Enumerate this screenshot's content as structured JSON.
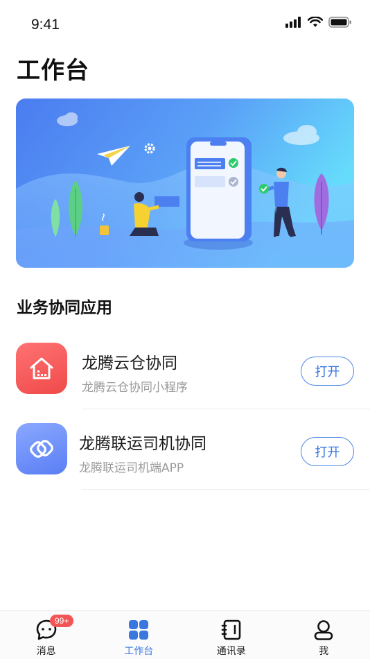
{
  "status_bar": {
    "time": "9:41"
  },
  "page": {
    "title": "工作台"
  },
  "section": {
    "title": "业务协同应用"
  },
  "apps": [
    {
      "name": "龙腾云仓协同",
      "desc": "龙腾云仓协同小程序",
      "button": "打开",
      "icon": "warehouse-house-icon"
    },
    {
      "name": "龙腾联运司机协同",
      "desc": "龙腾联运司机端APP",
      "button": "打开",
      "icon": "link-icon"
    }
  ],
  "tabs": [
    {
      "label": "消息",
      "icon": "chat-bubble-icon",
      "badge": "99+"
    },
    {
      "label": "工作台",
      "icon": "grid-apps-icon",
      "active": true
    },
    {
      "label": "通讯录",
      "icon": "contacts-book-icon"
    },
    {
      "label": "我",
      "icon": "profile-icon"
    }
  ],
  "colors": {
    "accent": "#3a78e0",
    "badge": "#f25555",
    "warehouse_icon": "#f04a4a",
    "transport_icon": "#5a7ef5"
  }
}
